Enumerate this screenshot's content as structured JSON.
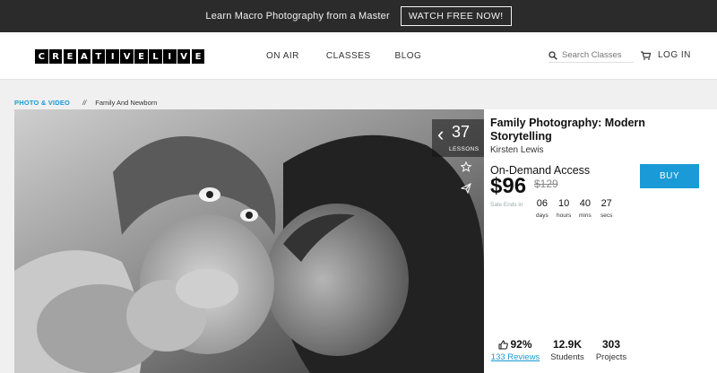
{
  "promo": {
    "text": "Learn Macro Photography from a Master",
    "button": "WATCH FREE NOW!"
  },
  "nav": {
    "logo_letters": [
      "C",
      "R",
      "E",
      "A",
      "T",
      "I",
      "V",
      "E",
      "L",
      "I",
      "V",
      "E"
    ],
    "links": [
      "ON AIR",
      "CLASSES",
      "BLOG"
    ],
    "search_placeholder": "Search Classes",
    "login": "LOG IN",
    "icons": {
      "search": "search-icon",
      "login": "cart-icon"
    }
  },
  "breadcrumb": {
    "category": "PHOTO & VIDEO",
    "separator": "//",
    "subcategory": "Family And Newborn"
  },
  "hero": {
    "lessons_count": "37",
    "lessons_label": "LESSONS",
    "icons": [
      "star-icon",
      "share-icon"
    ]
  },
  "course": {
    "title": "Family Photography: Modern Storytelling",
    "instructor": "Kirsten Lewis",
    "access": "On-Demand Access",
    "price": "$96",
    "old_price": "$129",
    "buy_label": "BUY",
    "sale_label": "Sale Ends in",
    "countdown": [
      {
        "value": "06",
        "unit": "days"
      },
      {
        "value": "10",
        "unit": "hours"
      },
      {
        "value": "40",
        "unit": "mins"
      },
      {
        "value": "27",
        "unit": "secs"
      }
    ],
    "stats": {
      "rating": "92%",
      "reviews": "133 Reviews",
      "students": "12.9K",
      "students_label": "Students",
      "projects": "303",
      "projects_label": "Projects"
    }
  },
  "colors": {
    "accent": "#1a9ad6",
    "promo_bg": "#2b2b2b",
    "page_bg": "#f0f0f0"
  }
}
